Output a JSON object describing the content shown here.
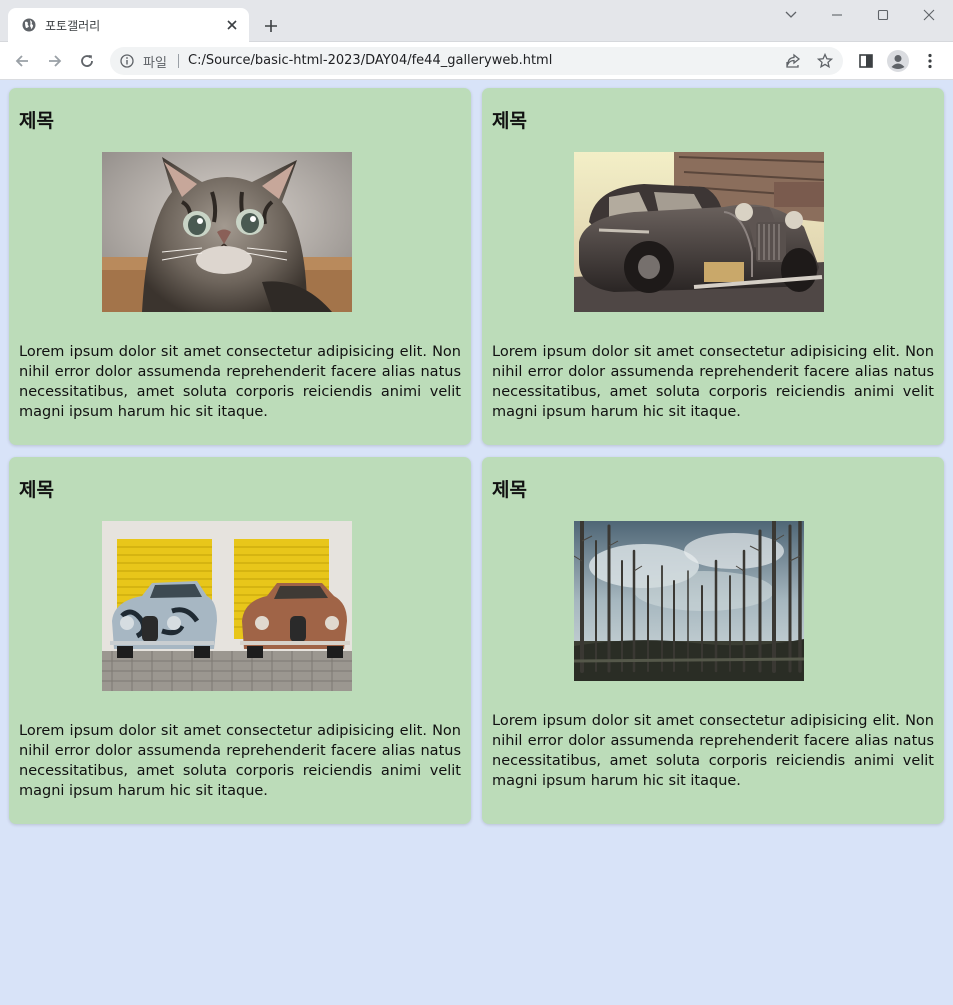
{
  "browser": {
    "tab_title": "포토갤러리",
    "scheme_label": "파일",
    "url": "C:/Source/basic-html-2023/DAY04/fe44_galleryweb.html"
  },
  "cards": [
    {
      "title": "제목",
      "image": "kitten-photo",
      "text": "Lorem ipsum dolor sit amet consectetur adipisicing elit. Non nihil error dolor assumenda reprehenderit facere alias natus necessitatibus, amet soluta corporis reiciendis animi velit magni ipsum harum hic sit itaque."
    },
    {
      "title": "제목",
      "image": "vintage-car-photo",
      "text": "Lorem ipsum dolor sit amet consectetur adipisicing elit. Non nihil error dolor assumenda reprehenderit facere alias natus necessitatibus, amet soluta corporis reiciendis animi velit magni ipsum harum hic sit itaque."
    },
    {
      "title": "제목",
      "image": "two-jaguar-cars-photo",
      "text": "Lorem ipsum dolor sit amet consectetur adipisicing elit. Non nihil error dolor assumenda reprehenderit facere alias natus necessitatibus, amet soluta corporis reiciendis animi velit magni ipsum harum hic sit itaque."
    },
    {
      "title": "제목",
      "image": "forest-photo",
      "text": "Lorem ipsum dolor sit amet consectetur adipisicing elit. Non nihil error dolor assumenda reprehenderit facere alias natus necessitatibus, amet soluta corporis reiciendis animi velit magni ipsum harum hic sit itaque."
    }
  ],
  "colors": {
    "page_background": "#d8e3f8",
    "card_background": "#bcdcb9"
  }
}
